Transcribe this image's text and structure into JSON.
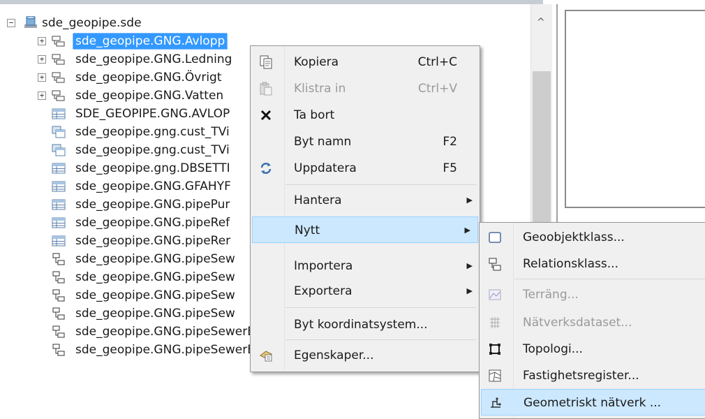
{
  "tree": {
    "root": {
      "label": "sde_geopipe.sde",
      "expander": "−",
      "icon": "database-icon"
    },
    "items": [
      {
        "label": "sde_geopipe.GNG.Avlopp",
        "expander": "+",
        "icon": "feature-dataset-icon",
        "selected": true
      },
      {
        "label": "sde_geopipe.GNG.Ledning",
        "expander": "+",
        "icon": "feature-dataset-icon"
      },
      {
        "label": "sde_geopipe.GNG.Övrigt",
        "expander": "+",
        "icon": "feature-dataset-icon"
      },
      {
        "label": "sde_geopipe.GNG.Vatten",
        "expander": "+",
        "icon": "feature-dataset-icon"
      },
      {
        "label": "SDE_GEOPIPE.GNG.AVLOP",
        "icon": "table-icon"
      },
      {
        "label": "sde_geopipe.gng.cust_TVi",
        "icon": "view-icon"
      },
      {
        "label": "sde_geopipe.gng.cust_TVi",
        "icon": "view-icon"
      },
      {
        "label": "sde_geopipe.gng.DBSETTI",
        "icon": "table-icon"
      },
      {
        "label": "sde_geopipe.GNG.GFAHYF",
        "icon": "table-icon"
      },
      {
        "label": "sde_geopipe.GNG.pipePur",
        "icon": "table-icon"
      },
      {
        "label": "sde_geopipe.GNG.pipeRef",
        "icon": "table-icon"
      },
      {
        "label": "sde_geopipe.GNG.pipeRer",
        "icon": "table-icon"
      },
      {
        "label": "sde_geopipe.GNG.pipeSew",
        "icon": "relationship-class-icon"
      },
      {
        "label": "sde_geopipe.GNG.pipeSew",
        "icon": "relationship-class-icon"
      },
      {
        "label": "sde_geopipe.GNG.pipeSew",
        "icon": "relationship-class-icon"
      },
      {
        "label": "sde_geopipe.GNG.pipeSew",
        "icon": "relationship-class-icon"
      },
      {
        "label": "sde_geopipe.GNG.pipeSewerBreakPoint_pipeReference",
        "icon": "relationship-class-icon"
      },
      {
        "label": "sde_geopipe.GNG.pipeSewerBreakPoint_pipeRemark",
        "icon": "relationship-class-icon"
      }
    ]
  },
  "context_menu": {
    "items": [
      {
        "label": "Kopiera",
        "shortcut": "Ctrl+C",
        "icon": "copy-icon"
      },
      {
        "label": "Klistra in",
        "shortcut": "Ctrl+V",
        "icon": "paste-icon",
        "disabled": true
      },
      {
        "label": "Ta bort",
        "shortcut": "",
        "icon": "delete-icon"
      },
      {
        "label": "Byt namn",
        "shortcut": "F2",
        "icon": ""
      },
      {
        "label": "Uppdatera",
        "shortcut": "F5",
        "icon": "refresh-icon"
      },
      {
        "label": "Hantera",
        "submenu": true
      },
      {
        "label": "Nytt",
        "submenu": true,
        "highlighted": true
      },
      {
        "label": "Importera",
        "submenu": true
      },
      {
        "label": "Exportera",
        "submenu": true
      },
      {
        "label": "Byt koordinatsystem...",
        "shortcut": ""
      },
      {
        "label": "Egenskaper...",
        "icon": "properties-icon"
      }
    ]
  },
  "submenu": {
    "items": [
      {
        "label": "Geoobjektklass...",
        "icon": "feature-class-icon"
      },
      {
        "label": "Relationsklass...",
        "icon": "relationship-class-icon"
      },
      {
        "label": "Terräng...",
        "icon": "terrain-icon",
        "disabled": true
      },
      {
        "label": "Nätverksdataset...",
        "icon": "network-dataset-icon",
        "disabled": true
      },
      {
        "label": "Topologi...",
        "icon": "topology-icon"
      },
      {
        "label": "Fastighetsregister...",
        "icon": "parcel-fabric-icon"
      },
      {
        "label": "Geometriskt nätverk ...",
        "icon": "geometric-network-icon",
        "highlighted": true
      }
    ]
  }
}
